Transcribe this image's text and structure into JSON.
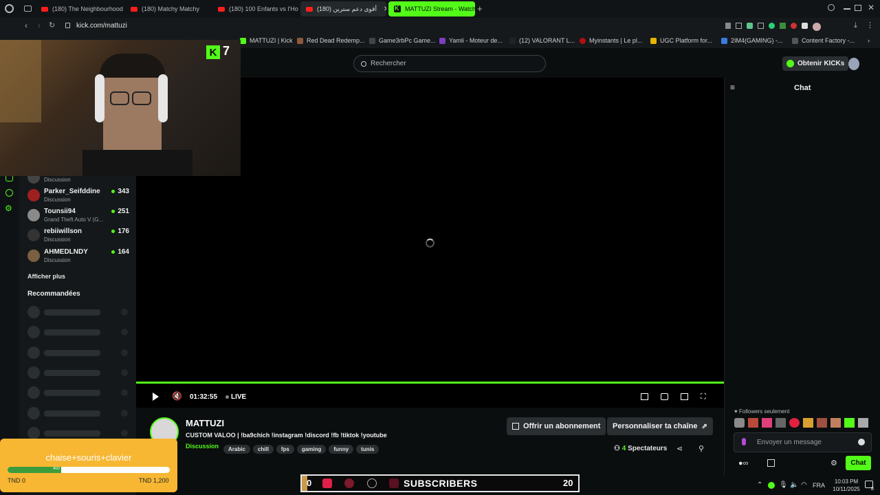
{
  "browser": {
    "tabs": [
      {
        "label": "(180) The Neighbourhood",
        "kind": "youtube"
      },
      {
        "label": "(180) Matchy Matchy",
        "kind": "youtube"
      },
      {
        "label": "(180) 100 Enfants vs l'Ho",
        "kind": "youtube"
      },
      {
        "label": "(180) أقوى دعم سترين",
        "kind": "youtube",
        "active": true
      },
      {
        "label": "MATTUZI Stream - Watch",
        "kind": "kick",
        "selected": true
      }
    ],
    "url": "kick.com/mattuzi",
    "bookmarks": [
      {
        "label": "MATTUZI | Kick"
      },
      {
        "label": "Red Dead Redemp..."
      },
      {
        "label": "Game3rbPc Game..."
      },
      {
        "label": "Yamli - Moteur de..."
      },
      {
        "label": "(12) VALORANT L..."
      },
      {
        "label": "Myinstants | Le pl..."
      },
      {
        "label": "UGC Platform for..."
      },
      {
        "label": "2IM4(GAMING) -..."
      },
      {
        "label": "Content Factory -..."
      }
    ]
  },
  "header": {
    "search_placeholder": "Rechercher",
    "kicks_label": "Obtenir KICKs"
  },
  "sidebar": {
    "channels": [
      {
        "name": "",
        "category": "Discussion",
        "viewers": ""
      },
      {
        "name": "Parker_Seifddine",
        "category": "Discussion",
        "viewers": "343"
      },
      {
        "name": "Tounsii94",
        "category": "Grand Theft Auto V (G...",
        "viewers": "251"
      },
      {
        "name": "rebiiwillson",
        "category": "Discussion",
        "viewers": "176"
      },
      {
        "name": "AHMEDLNDY",
        "category": "Discussion",
        "viewers": "164"
      }
    ],
    "show_more": "Afficher plus",
    "recommended_title": "Recommandées"
  },
  "overlay": {
    "kick_badge": "7"
  },
  "player": {
    "time": "01:32:55",
    "live_label": "LIVE"
  },
  "chat": {
    "title": "Chat",
    "followers_only": "Followers seulement",
    "input_placeholder": "Envoyer un message",
    "send_label": "Chat"
  },
  "channel": {
    "name": "MATTUZI",
    "stream_title": "CUSTOM VALOO | !ba9chich !instagram !discord !fb !tiktok !youtube",
    "category": "Discussion",
    "tags": [
      "Arabic",
      "chill",
      "fps",
      "gaming",
      "funny",
      "tunis"
    ],
    "subscribe_label": "Offrir un abonnement",
    "customize_label": "Personnaliser ta chaîne",
    "viewers_count": "4",
    "viewers_label": "Spectateurs"
  },
  "donation": {
    "goal_text": "chaise+souris+clavier",
    "progress_value": "400",
    "progress_fraction": 0.33,
    "current": "TND 0",
    "target": "TND 1,200"
  },
  "subs_widget": {
    "left_value": "0",
    "label": "SUBSCRIBERS",
    "right_value": "20"
  },
  "taskbar": {
    "language": "FRA",
    "time": "10:03 PM",
    "date": "10/11/2025",
    "notif_count": "8"
  }
}
